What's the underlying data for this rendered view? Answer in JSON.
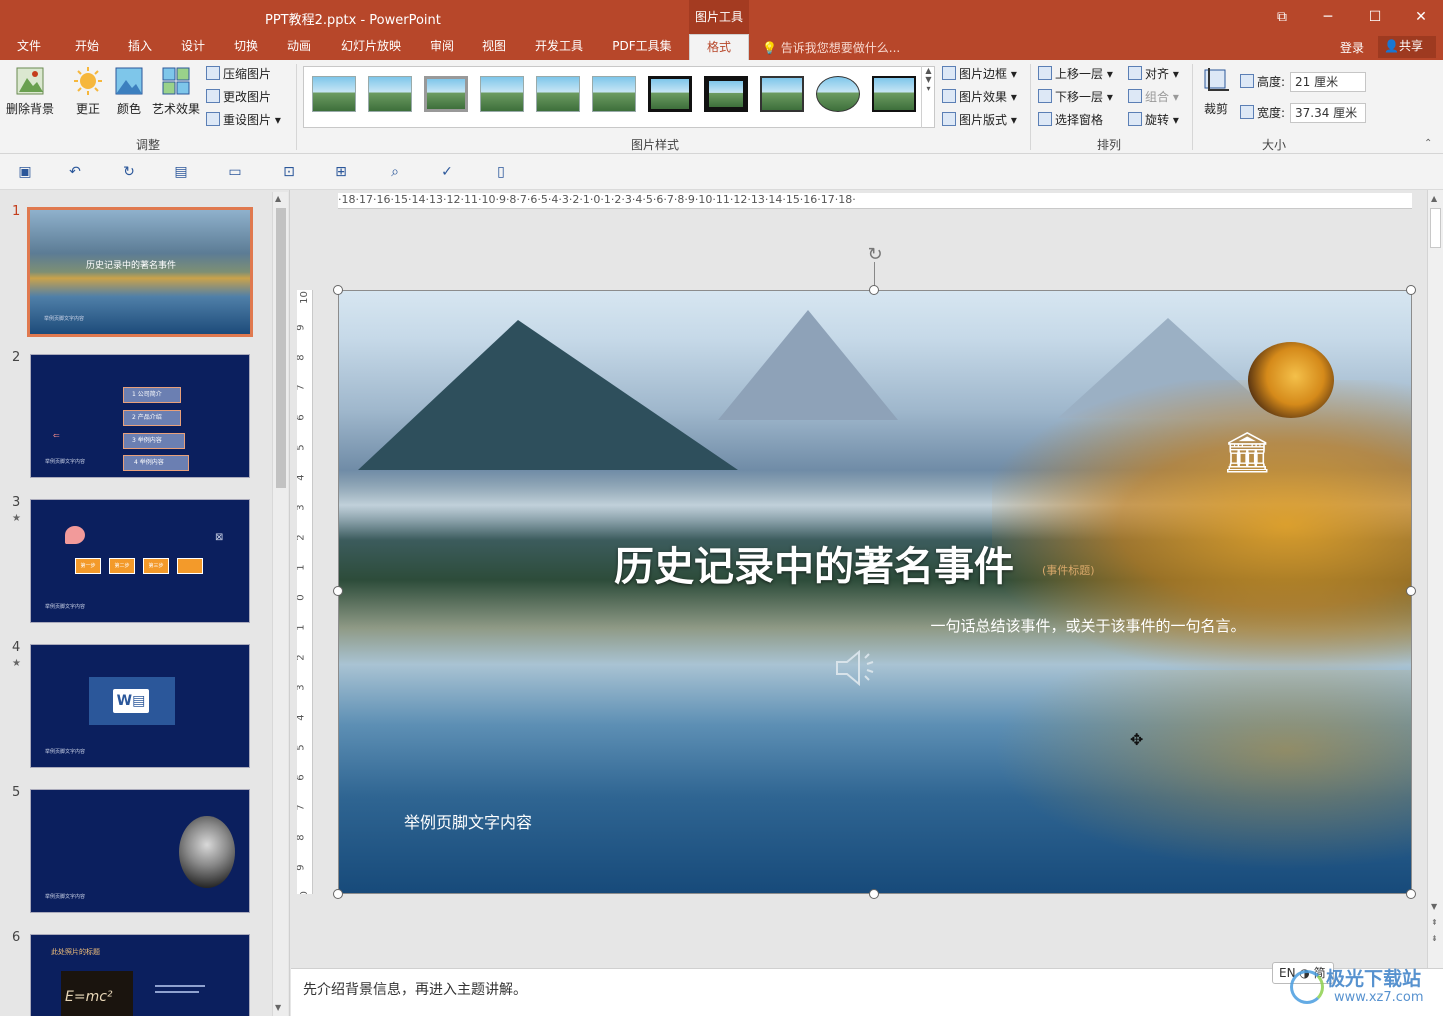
{
  "window": {
    "title": "PPT教程2.pptx - PowerPoint",
    "context_tab": "图片工具",
    "btn_restore": "⧉",
    "btn_minimize": "─",
    "btn_maximize": "☐",
    "btn_close": "✕"
  },
  "tabs": [
    {
      "label": "文件"
    },
    {
      "label": "开始"
    },
    {
      "label": "插入"
    },
    {
      "label": "设计"
    },
    {
      "label": "切换"
    },
    {
      "label": "动画"
    },
    {
      "label": "幻灯片放映"
    },
    {
      "label": "审阅"
    },
    {
      "label": "视图"
    },
    {
      "label": "开发工具"
    },
    {
      "label": "PDF工具集"
    },
    {
      "label": "格式"
    }
  ],
  "active_tab": "格式",
  "tell_me": "告诉我您想要做什么...",
  "login": "登录",
  "share": "共享",
  "ribbon": {
    "adjust": {
      "remove_bg": "删除背景",
      "corrections": "更正",
      "color": "颜色",
      "artistic": "艺术效果",
      "compress": "压缩图片",
      "change": "更改图片",
      "reset": "重设图片",
      "group_label": "调整"
    },
    "styles": {
      "border": "图片边框",
      "effects": "图片效果",
      "layout": "图片版式",
      "group_label": "图片样式"
    },
    "arrange": {
      "bring_forward": "上移一层",
      "send_backward": "下移一层",
      "selection_pane": "选择窗格",
      "align": "对齐",
      "group": "组合",
      "rotate": "旋转",
      "group_label": "排列"
    },
    "size": {
      "crop": "裁剪",
      "height_label": "高度:",
      "height_value": "21 厘米",
      "width_label": "宽度:",
      "width_value": "37.34 厘米",
      "group_label": "大小"
    }
  },
  "ruler_h": "·18·17·16·15·14·13·12·11·10·9·8·7·6·5·4·3·2·1·0·1·2·3·4·5·6·7·8·9·10·11·12·13·14·15·16·17·18·",
  "ruler_v": [
    "10",
    "9",
    "8",
    "7",
    "6",
    "5",
    "4",
    "3",
    "2",
    "1",
    "0",
    "1",
    "2",
    "3",
    "4",
    "5",
    "6",
    "7",
    "8",
    "9",
    "10"
  ],
  "thumbnails": [
    {
      "num": "1",
      "footer": "举例页脚文字内容"
    },
    {
      "num": "2",
      "footer": "举例页脚文字内容",
      "items": [
        "1 公司简介",
        "2 产品介绍",
        "3 举例内容",
        "4 举例内容"
      ]
    },
    {
      "num": "3",
      "star": "★",
      "footer": "举例页脚文字内容",
      "boxes": [
        "第一步",
        "第二步",
        "第三步"
      ]
    },
    {
      "num": "4",
      "star": "★",
      "footer": "举例页脚文字内容"
    },
    {
      "num": "5",
      "footer": "举例页脚文字内容"
    },
    {
      "num": "6",
      "title": "此处照片的标题",
      "formula": "E=mc²"
    }
  ],
  "slide": {
    "title": "历史记录中的著名事件",
    "title_tag": "(事件标题)",
    "subtitle": "一句话总结该事件，或关于该事件的一句名言。",
    "footer": "举例页脚文字内容"
  },
  "notes": "先介绍背景信息，再进入主题讲解。",
  "ime": "EN ◑ 简",
  "watermark": {
    "name": "极光下载站",
    "url": "www.xz7.com"
  },
  "colors": {
    "accent": "#b7472a",
    "slide_bg": "#0b1f5e"
  }
}
